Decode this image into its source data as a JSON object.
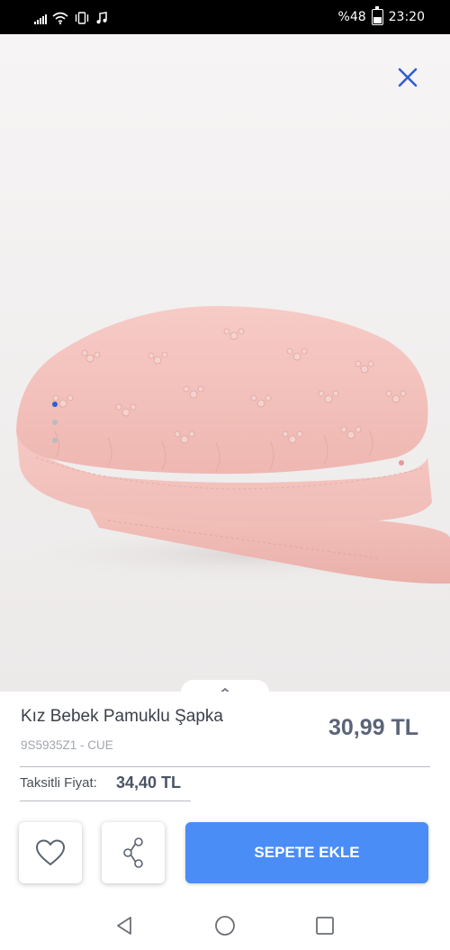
{
  "status_bar": {
    "battery": "%48",
    "time": "23:20",
    "icons": [
      "signal-icon",
      "wifi-icon",
      "vibrate-icon",
      "music-note-icon",
      "battery-icon"
    ]
  },
  "gallery": {
    "close_icon": "close-icon",
    "image_count": 3,
    "active_index": 0,
    "dot_colors": {
      "active": "#2f5fd0",
      "inactive": "#b9bcc0"
    }
  },
  "product": {
    "title": "Kız Bebek Pamuklu Şapka",
    "code": "9S5935Z1 - CUE",
    "price": "30,99 TL",
    "installment_label": "Taksitli Fiyat:",
    "installment_price": "34,40 TL"
  },
  "actions": {
    "favorite_icon": "heart-icon",
    "share_icon": "share-icon",
    "add_to_cart_label": "SEPETE EKLE",
    "cart_color": "#4a8df6"
  },
  "nav": {
    "icons": [
      "back-icon",
      "home-icon",
      "recent-apps-icon"
    ]
  },
  "colors": {
    "hat": "#f4c4bf",
    "accent": "#2f5fd0"
  }
}
